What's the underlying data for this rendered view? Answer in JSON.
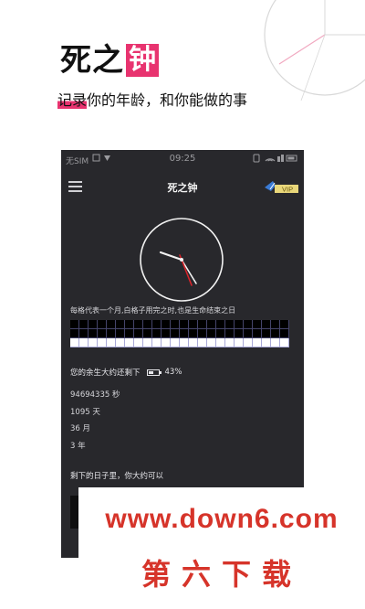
{
  "promo": {
    "title_plain": "死之",
    "title_highlight": "钟",
    "subtitle_highlight": "记录",
    "subtitle_rest": "你的年龄，和你能做的事"
  },
  "statusbar": {
    "carrier": "无SIM",
    "time": "09:25"
  },
  "app": {
    "title": "死之钟",
    "vip_label": "VIP",
    "grid_description": "每格代表一个月,白格子用完之时,也是生命结束之日",
    "grid": {
      "columns": 24,
      "rows": 3,
      "used_months": 48,
      "remaining_months": 36
    },
    "remaining_label": "您的余生大约还剩下",
    "battery_percent": 43,
    "battery_text": "43%",
    "stats": [
      {
        "value": "94694335",
        "unit": "秒",
        "text": "94694335 秒"
      },
      {
        "value": "1095",
        "unit": "天",
        "text": "1095 天"
      },
      {
        "value": "36",
        "unit": "月",
        "text": "36 月"
      },
      {
        "value": "3",
        "unit": "年",
        "text": "3 年"
      }
    ],
    "bottom_label": "剩下的日子里，你大约可以"
  },
  "watermark": {
    "url": "www.down6.com",
    "cn": "第六下载"
  },
  "colors": {
    "accent": "#e8336f",
    "phone_bg": "#28282c",
    "watermark": "#d6342a"
  }
}
